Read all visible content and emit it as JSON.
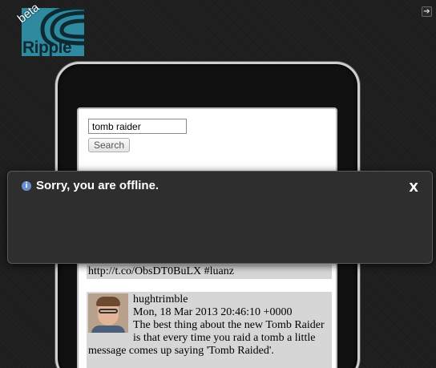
{
  "app": {
    "logo_text": "Ripple",
    "beta_label": "beta",
    "exit_icon": "arrow-right-icon"
  },
  "search": {
    "value": "tomb raider",
    "button_label": "Search"
  },
  "tweets": [
    {
      "text": "http://t.co/ObsDT0BuLX #luanz"
    },
    {
      "user": "hughtrimble",
      "date": "Mon, 18 Mar 2013 20:46:10 +0000",
      "text": "The best thing about the new Tomb Raider is that every time you raid a tomb a little message comes up saying 'Tomb Raided'."
    }
  ],
  "offline_dialog": {
    "icon": "info-icon",
    "message": "Sorry, you are offline.",
    "close_label": "X"
  },
  "colors": {
    "background": "#1e1e1e",
    "logo_teal": "#2f8aa0",
    "dialog_bg": "#2e2e2e",
    "info_blue": "#6a8fd0"
  }
}
